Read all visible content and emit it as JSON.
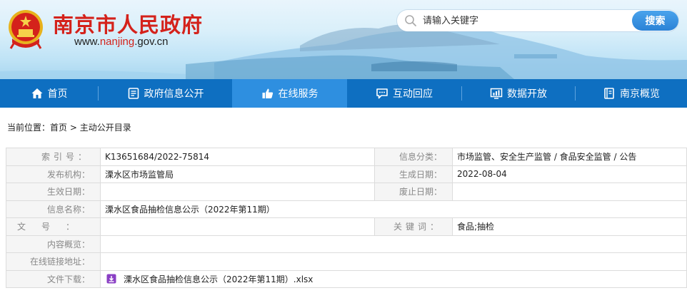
{
  "header": {
    "site_title": "南京市人民政府",
    "domain_prefix": "www.",
    "domain_accent": "nanjing",
    "domain_suffix": ".gov.cn",
    "search_placeholder": "请输入关键字",
    "search_button": "搜索",
    "brand_red": "#d4221b",
    "brand_blue": "#0e6fc1"
  },
  "nav": {
    "items": [
      {
        "label": "首页",
        "icon": "home-icon"
      },
      {
        "label": "政府信息公开",
        "icon": "document-icon"
      },
      {
        "label": "在线服务",
        "icon": "thumbs-up-icon",
        "active": true
      },
      {
        "label": "互动回应",
        "icon": "chat-icon"
      },
      {
        "label": "数据开放",
        "icon": "chart-icon"
      },
      {
        "label": "南京概览",
        "icon": "book-icon"
      }
    ]
  },
  "breadcrumb": {
    "prefix": "当前位置：",
    "home": "首页",
    "sep": " > ",
    "current": "主动公开目录"
  },
  "info": {
    "index_label": "索引号：",
    "index_value": "K13651684/2022-75814",
    "category_label": "信息分类：",
    "category_value": "市场监管、安全生产监管 / 食品安全监管 / 公告",
    "publisher_label": "发布机构：",
    "publisher_value": "溧水区市场监管局",
    "created_label": "生成日期：",
    "created_value": "2022-08-04",
    "effective_label": "生效日期：",
    "effective_value": "",
    "expired_label": "废止日期：",
    "expired_value": "",
    "name_label": "信息名称：",
    "name_value": "溧水区食品抽检信息公示（2022年第11期）",
    "docno_label": "文号：",
    "docno_value": "",
    "keywords_label": "关键词：",
    "keywords_value": "食品;抽检",
    "summary_label": "内容概览：",
    "summary_value": "",
    "link_label": "在线链接地址：",
    "link_value": "",
    "download_label": "文件下载：",
    "download_file": "溧水区食品抽检信息公示（2022年第11期）.xlsx"
  }
}
